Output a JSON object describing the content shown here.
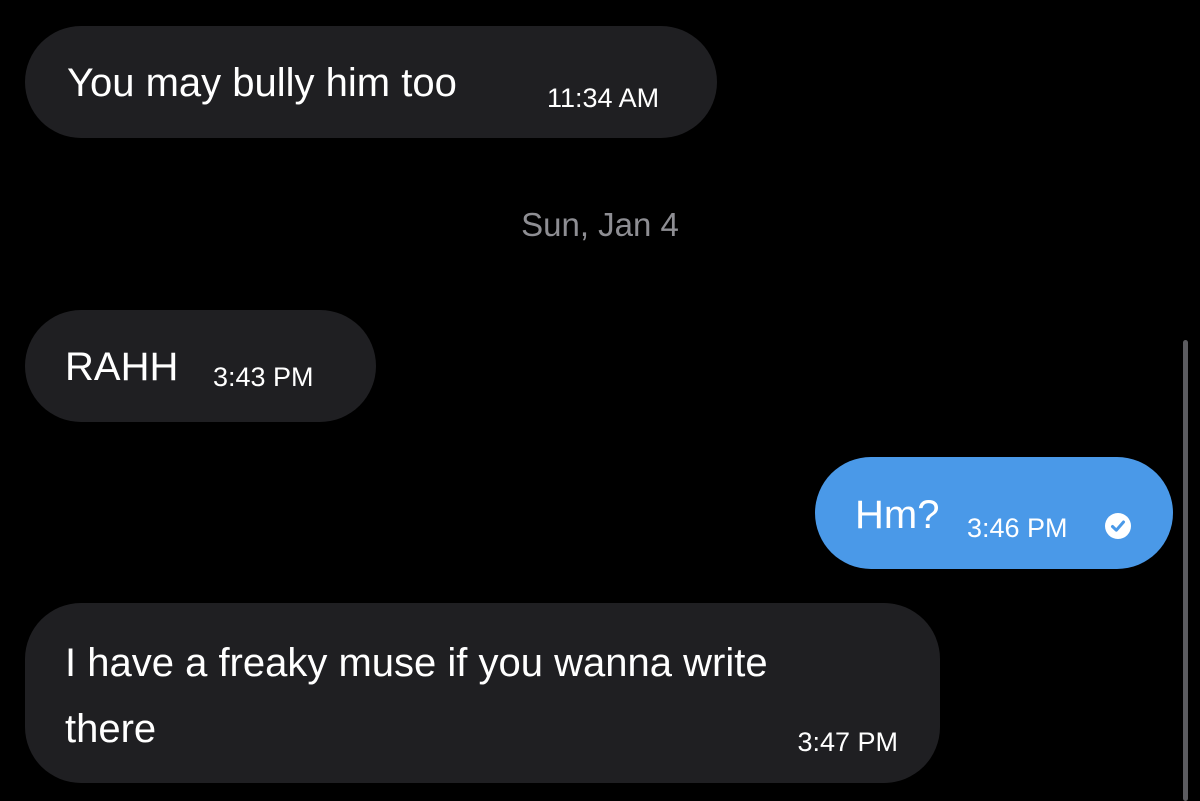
{
  "conversation": {
    "messages": [
      {
        "direction": "incoming",
        "text": "You may bully him too",
        "time": "11:34 AM"
      },
      {
        "direction": "incoming",
        "text": "RAHH",
        "time": "3:43 PM"
      },
      {
        "direction": "outgoing",
        "text": "Hm?",
        "time": "3:46 PM",
        "status_icon": "read-check-icon"
      },
      {
        "direction": "incoming",
        "text_lines": [
          "I have a freaky muse if you wanna write",
          "there"
        ],
        "time": "3:47 PM"
      }
    ],
    "date_separator": "Sun, Jan 4"
  },
  "colors": {
    "background": "#000000",
    "incoming_bubble": "#1f1f22",
    "outgoing_bubble": "#4a99e8",
    "date_separator_text": "#8e8e93",
    "text": "#ffffff"
  }
}
